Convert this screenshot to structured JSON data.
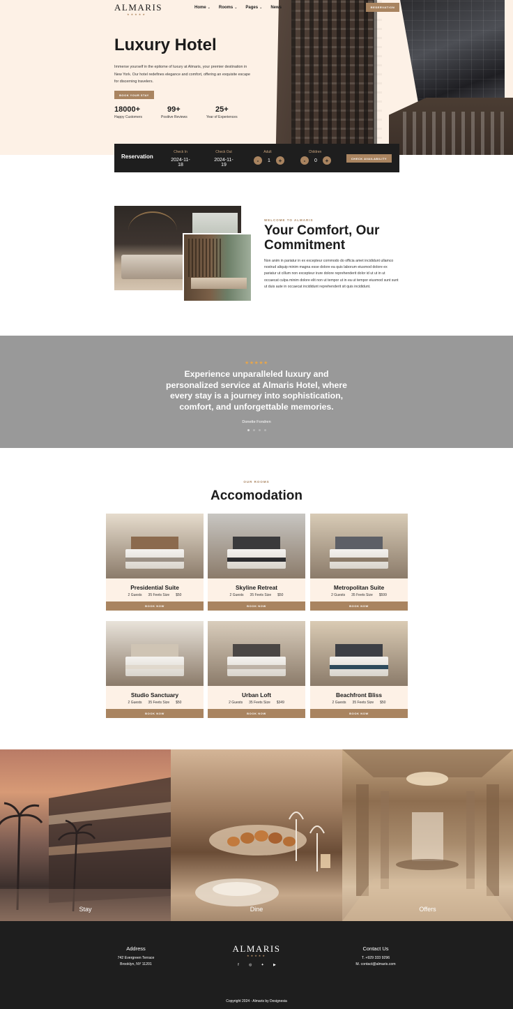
{
  "header": {
    "brand": "ALMARIS",
    "brand_stars": "★★★★★",
    "nav": [
      {
        "label": "Home",
        "has_dropdown": true
      },
      {
        "label": "Rooms",
        "has_dropdown": true
      },
      {
        "label": "Pages",
        "has_dropdown": true
      },
      {
        "label": "News",
        "has_dropdown": false
      }
    ],
    "reservation_button": "RESERVATION"
  },
  "hero": {
    "title": "Luxury Hotel",
    "text": "Immerse yourself in the epitome of luxury at Almaris, your premier destination in New York. Our hotel redefines elegance and comfort, offering an exquisite escape for discerning travelers.",
    "book_button": "BOOK YOUR STAY",
    "stats": [
      {
        "value": "18000+",
        "label": "Happy Customers"
      },
      {
        "value": "99+",
        "label": "Positive Reviews"
      },
      {
        "value": "25+",
        "label": "Year of Experiences"
      }
    ]
  },
  "reservation": {
    "title": "Reservation",
    "check_in": {
      "label": "Check In",
      "value": "2024-11-18"
    },
    "check_out": {
      "label": "Check Out",
      "value": "2024-11-19"
    },
    "adult": {
      "label": "Adult",
      "value": "1"
    },
    "children": {
      "label": "Children",
      "value": "0"
    },
    "minus": "-",
    "plus": "+",
    "button": "CHECK AVAILABILITY"
  },
  "about": {
    "eyebrow": "WELCOME TO ALMARIS",
    "title": "Your Comfort, Our Commitment",
    "text": "Non anim in pariatur in ex excepteur commodo do officia amet incididunt ullamco nostrud aliquip minim magna esse dolore ea quis laborum eiusmod dolore ex pariatur ut cillum non excepteur irure dolore reprehenderit dolor id ut ut in ut occaecat culpa minim dolore elit non ut tempor ut in ea ut tempor eiusmod sunt sunt ut duis aute in occaecat incididunt reprehenderit sit quis incididunt."
  },
  "testimonial": {
    "stars": "★★★★★",
    "quote": "Experience unparalleled luxury and personalized service at Almaris Hotel, where every stay is a journey into sophistication, comfort, and unforgettable memories.",
    "author": "Donette Fondren",
    "dots": 4,
    "active_dot": 0
  },
  "rooms": {
    "eyebrow": "OUR ROOMS",
    "title": "Accomodation",
    "book_label": "BOOK NOW",
    "items": [
      {
        "name": "Presidential Suite",
        "guests": "2 Guests",
        "size": "35 Feets Size",
        "price": "$50",
        "wall": "#e6dccd",
        "head": "#8b6a4e",
        "runner": "#9a8f84"
      },
      {
        "name": "Skyline Retreat",
        "guests": "2 Guests",
        "size": "35 Feets Size",
        "price": "$50",
        "wall": "#c8c6c2",
        "head": "#3a3a3c",
        "runner": "#2c2c2e"
      },
      {
        "name": "Metropolitan Suite",
        "guests": "2 Guests",
        "size": "35 Feets Size",
        "price": "$599",
        "wall": "#d8cbb6",
        "head": "#5d5f66",
        "runner": "#8a7a68"
      },
      {
        "name": "Studio Sanctuary",
        "guests": "2 Guests",
        "size": "35 Feets Size",
        "price": "$50",
        "wall": "#e9e3da",
        "head": "#cfc4b4",
        "runner": "#e0d8cc"
      },
      {
        "name": "Urban Loft",
        "guests": "2 Guests",
        "size": "35 Feets Size",
        "price": "$349",
        "wall": "#d9cdbc",
        "head": "#4a4644",
        "runner": "#bdb2a6"
      },
      {
        "name": "Beachfront Bliss",
        "guests": "2 Guests",
        "size": "35 Feets Size",
        "price": "$50",
        "wall": "#dacbb4",
        "head": "#3d3f45",
        "runner": "#2d4a5c"
      }
    ]
  },
  "features": [
    {
      "label": "Stay",
      "bg": "#7a5a4a"
    },
    {
      "label": "Dine",
      "bg": "#8e6a4e"
    },
    {
      "label": "Offers",
      "bg": "#a78b68"
    }
  ],
  "footer": {
    "address_title": "Address",
    "address_line1": "742 Evergreen Terrace",
    "address_line2": "Brooklyn, NY 11201",
    "logo": "ALMARIS",
    "logo_stars": "★★★★★",
    "social": [
      "facebook-icon",
      "instagram-icon",
      "twitter-icon",
      "youtube-icon"
    ],
    "contact_title": "Contact Us",
    "phone": "T. +929 333 9296",
    "email": "M. contact@almaris.com",
    "copyright": "Copyright 2024 - Almaris by Designesia"
  },
  "colors": {
    "accent": "#a98460",
    "hero_bg": "#fdf1e6",
    "dark": "#1e1e1e",
    "testimonial_bg": "#999999",
    "star": "#e8a64a"
  }
}
